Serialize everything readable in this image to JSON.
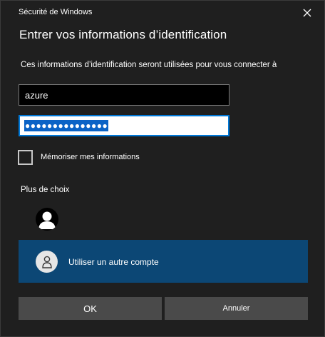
{
  "window": {
    "title": "Sécurité de Windows",
    "close_icon": "close-icon"
  },
  "dialog": {
    "heading": "Entrer vos informations d’identification",
    "description": "Ces informations d’identification seront utilisées pour vous connecter à"
  },
  "form": {
    "username_value": "azure",
    "password_mask": "●●●●●●●●●●●●●●●",
    "remember_label": "Mémoriser mes informations",
    "remember_checked": false
  },
  "choices": {
    "label": "Plus de choix",
    "accounts": [
      {
        "icon": "user-avatar-icon"
      }
    ],
    "other_account_label": "Utiliser un autre compte"
  },
  "buttons": {
    "ok": "OK",
    "cancel": "Annuler"
  },
  "colors": {
    "background": "#1f1f1f",
    "accent_selected": "#0c4775",
    "focus_border": "#0078d7",
    "button_bg": "#4a4a4a"
  }
}
